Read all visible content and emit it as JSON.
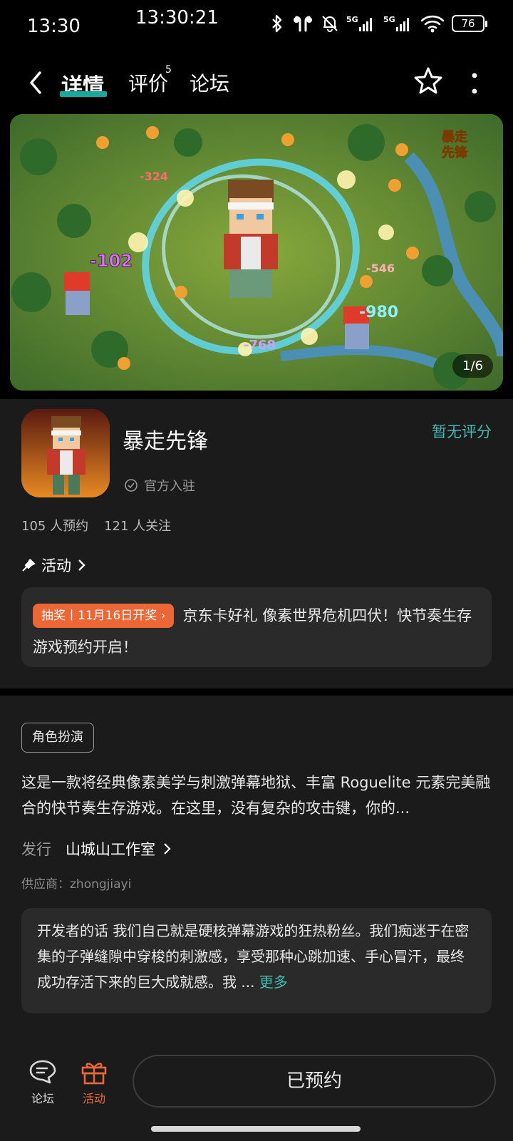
{
  "status_bar": {
    "time": "13:30",
    "clock": "13:30:21",
    "battery": "76",
    "icons": [
      "bluetooth-icon",
      "earbuds-icon",
      "mute-bell-icon",
      "signal-5g-icon",
      "signal-5g-icon",
      "wifi-icon"
    ]
  },
  "nav": {
    "tabs": [
      {
        "label": "详情"
      },
      {
        "label": "评价",
        "badge": "5"
      },
      {
        "label": "论坛"
      }
    ],
    "accent": "#19a8a0"
  },
  "hero": {
    "counter": "1/6",
    "logo_text": "暴走先锋",
    "damage_numbers": [
      "-324",
      "-102",
      "-546",
      "-980",
      "-768"
    ]
  },
  "app": {
    "name": "暴走先锋",
    "official": "官方入驻",
    "rating": "暂无评分",
    "reservations": "105 人预约",
    "followers": "121 人关注"
  },
  "activity": {
    "title": "活动",
    "tag": "抽奖丨11月16日开奖",
    "text": "京东卡好礼 像素世界危机四伏！快节奏生存游戏预约开启！"
  },
  "details": {
    "genre": "角色扮演",
    "description": "这是一款将经典像素美学与刺激弹幕地狱、丰富 Roguelite 元素完美融合的快节奏生存游戏。在这里，没有复杂的攻击键，你的...",
    "publisher_label": "发行",
    "publisher_name": "山城山工作室",
    "vendor": "供应商：zhongjiayi",
    "dev_words": "开发者的话  我们自己就是硬核弹幕游戏的狂热粉丝。我们痴迷于在密集的子弹缝隙中穿梭的刺激感，享受那种心跳加速、手心冒汗，最终成功存活下来的巨大成就感。我 ...",
    "more": "更多"
  },
  "bottom": {
    "forum": "论坛",
    "activity": "活动",
    "reserved": "已预约",
    "activity_color": "#ec6636"
  }
}
